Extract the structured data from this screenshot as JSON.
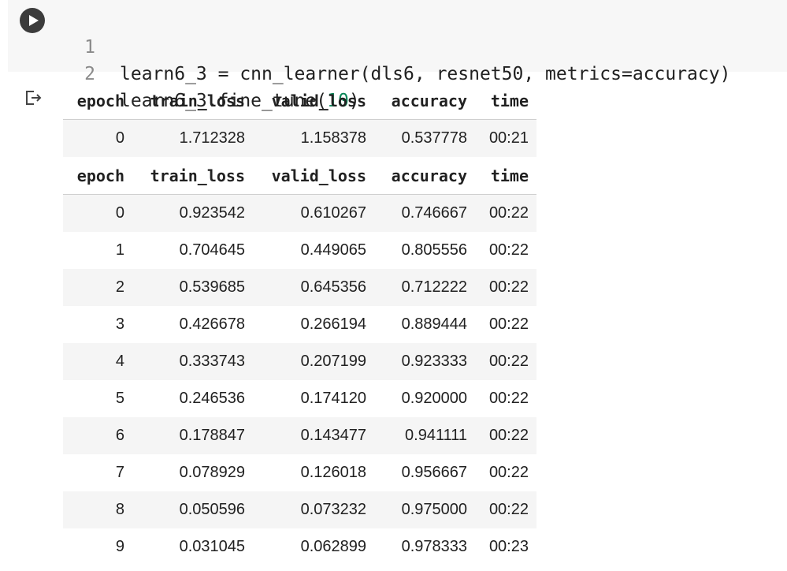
{
  "code_cell": {
    "lines": [
      {
        "number": "1",
        "text": "learn6_3 = cnn_learner(dls6, resnet50, metrics=accuracy)"
      },
      {
        "number": "2",
        "prefix": "learn6_3.fine_tune(",
        "arg": "10",
        "suffix": ")"
      }
    ],
    "run_icon": "play-icon"
  },
  "output": {
    "icon": "output-arrow-icon",
    "headers": [
      "epoch",
      "train_loss",
      "valid_loss",
      "accuracy",
      "time"
    ],
    "table1_rows": [
      [
        "0",
        "1.712328",
        "1.158378",
        "0.537778",
        "00:21"
      ]
    ],
    "table2_rows": [
      [
        "0",
        "0.923542",
        "0.610267",
        "0.746667",
        "00:22"
      ],
      [
        "1",
        "0.704645",
        "0.449065",
        "0.805556",
        "00:22"
      ],
      [
        "2",
        "0.539685",
        "0.645356",
        "0.712222",
        "00:22"
      ],
      [
        "3",
        "0.426678",
        "0.266194",
        "0.889444",
        "00:22"
      ],
      [
        "4",
        "0.333743",
        "0.207199",
        "0.923333",
        "00:22"
      ],
      [
        "5",
        "0.246536",
        "0.174120",
        "0.920000",
        "00:22"
      ],
      [
        "6",
        "0.178847",
        "0.143477",
        "0.941111",
        "00:22"
      ],
      [
        "7",
        "0.078929",
        "0.126018",
        "0.956667",
        "00:22"
      ],
      [
        "8",
        "0.050596",
        "0.073232",
        "0.975000",
        "00:22"
      ],
      [
        "9",
        "0.031045",
        "0.062899",
        "0.978333",
        "00:23"
      ]
    ]
  },
  "colors": {
    "code_background": "#f7f7f7",
    "number_literal": "#098658",
    "striped_row": "#f5f5f5"
  }
}
